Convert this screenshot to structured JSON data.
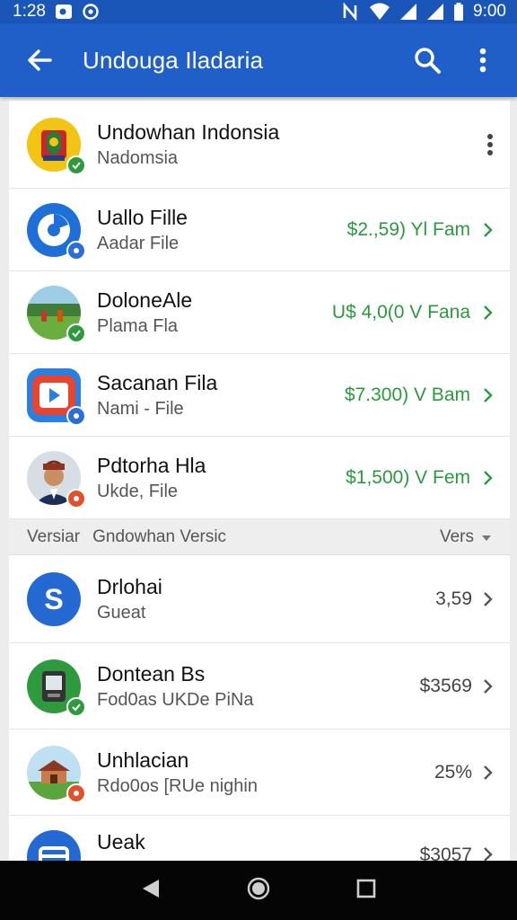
{
  "status_bar": {
    "time": "1:28",
    "clock": "9:00",
    "left_icons": [
      "notification-icon",
      "sync-icon"
    ],
    "right_icons": [
      "nfc-icon",
      "wifi-icon",
      "signal-icon",
      "signal-icon",
      "battery-icon"
    ]
  },
  "app_bar": {
    "title": "Undouga Iladaria",
    "back_icon": "arrow-back-icon",
    "search_icon": "search-icon",
    "more_icon": "more-vert-icon"
  },
  "colors": {
    "primary": "#1f5fc7",
    "status": "#1a55b8",
    "price_green": "#2a9a3c"
  },
  "items": [
    {
      "title": "Undowhan Indonsia",
      "subtitle": "Nadomsia",
      "avatar": "emblem",
      "badge_color": "#2e9a3e"
    },
    {
      "title": "Uallo Fille",
      "subtitle": "Aadar File",
      "price": "$2.,59) Yl Fam",
      "avatar": "blue-circle-icon",
      "badge_color": "#2b6fd6"
    },
    {
      "title": "DoloneAle",
      "subtitle": "Plama Fla",
      "price": "U$ 4,0(0  V Fana",
      "avatar": "field-photo",
      "badge_color": "#2e9a3e"
    },
    {
      "title": "Sacanan Fila",
      "subtitle": "Nami - File",
      "price": "$7.300) V Bam",
      "avatar": "video-play-icon",
      "badge_color": "#2b6fd6"
    },
    {
      "title": "Pdtorha Hla",
      "subtitle": "Ukde, File",
      "price": "$1,500) V Fem",
      "avatar": "person-photo",
      "badge_color": "#e0522b"
    }
  ],
  "section": {
    "label1": "Versiar",
    "label2": "Gndowhan Versic",
    "label3": "Vers"
  },
  "items2": [
    {
      "title": "Drlohai",
      "subtitle": "Gueat",
      "value": "3,59",
      "avatar": "s-letter-icon"
    },
    {
      "title": "Dontean Bs",
      "subtitle": "Fod0as UKDe PiNa",
      "value": "$3569",
      "avatar": "device-icon",
      "badge_color": "#2e9a3e"
    },
    {
      "title": "Unhlacian",
      "subtitle": "Rdo0os [RUe nighin",
      "value": "25%",
      "avatar": "house-photo",
      "badge_color": "#e0522b"
    },
    {
      "title": "Ueak",
      "subtitle": "",
      "value": "$3057",
      "avatar": "blue-card-icon"
    }
  ],
  "nav": [
    "back-triangle-icon",
    "home-circle-icon",
    "recents-square-icon"
  ]
}
